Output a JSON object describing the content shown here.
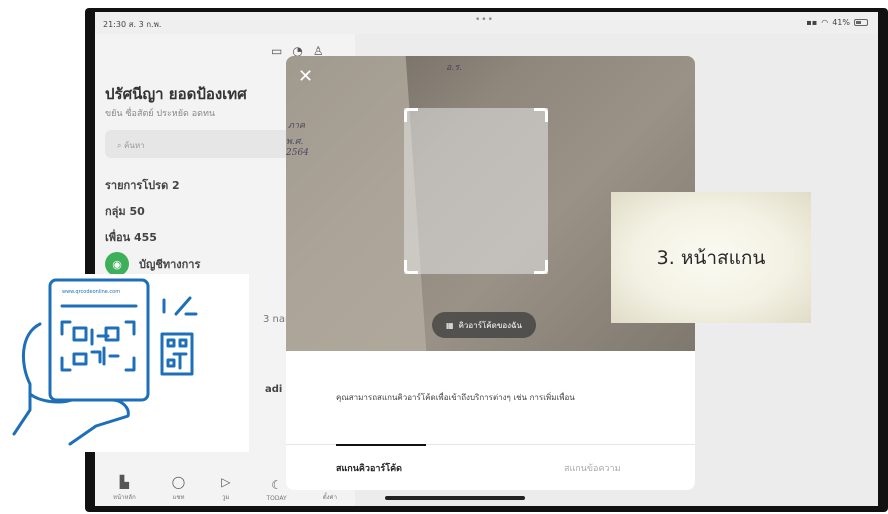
{
  "status_bar": {
    "time": "21:30 ส. 3 ก.พ.",
    "dots": "•••",
    "battery": "41%"
  },
  "left_panel": {
    "profile_name": "ปรัศนีญา ยอดป้องเทศ",
    "profile_status": "ขยัน ซื่อสัตย์ ประหยัด อดทน",
    "search_placeholder": "ค้นหา",
    "favorites": "รายการโปรด 2",
    "groups": "กลุ่ม 50",
    "friends": "เพื่อน 455",
    "official": "บัญชีทางการ",
    "peek_1": "3 nam.",
    "peek_2": "adi"
  },
  "bottom_nav": [
    {
      "label": "หน้าหลัก",
      "icon": "home-icon"
    },
    {
      "label": "แชท",
      "icon": "chat-icon"
    },
    {
      "label": "วูม",
      "icon": "voom-icon"
    },
    {
      "label": "TODAY",
      "icon": "today-icon"
    },
    {
      "label": "ตั้งค่า",
      "icon": "settings-icon"
    }
  ],
  "scanner": {
    "handwriting": [
      "อ.ร.",
      "ภาค",
      "พ.ศ.",
      "2564"
    ],
    "my_qr_label": "คิวอาร์โค้ดของฉัน",
    "description": "คุณสามารถสแกนคิวอาร์โค้ดเพื่อเข้าถึงบริการต่างๆ เช่น การเพิ่มเพื่อน",
    "tab_scan": "สแกนคิวอาร์โค้ด",
    "tab_text": "สแกนข้อความ"
  },
  "caption": "3. หน้าสแกน",
  "illustration": {
    "url_text": "www.qrcodeonline.com"
  },
  "colors": {
    "line_green": "#3fb05a",
    "illus_blue": "#1e6fb8"
  }
}
